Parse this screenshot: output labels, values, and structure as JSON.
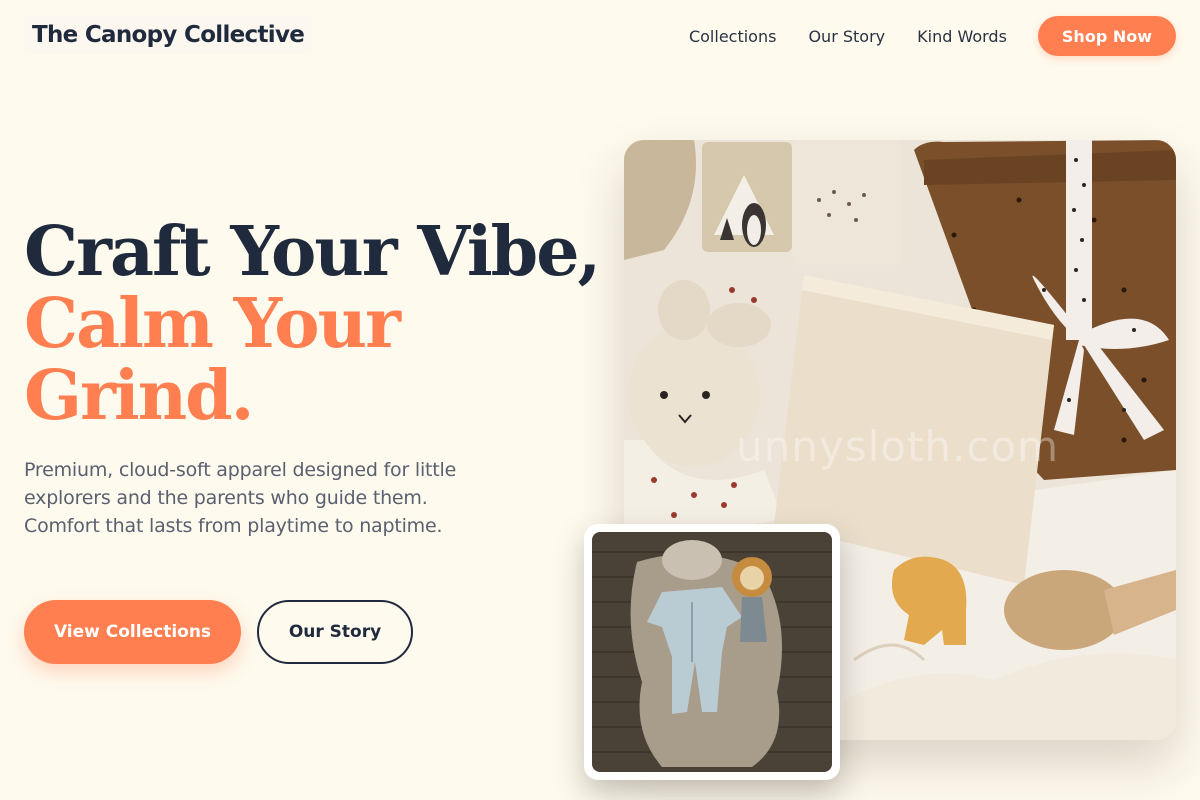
{
  "header": {
    "brand": "The Canopy Collective",
    "nav": [
      {
        "label": "Collections"
      },
      {
        "label": "Our Story"
      },
      {
        "label": "Kind Words"
      }
    ],
    "cta_label": "Shop Now"
  },
  "hero": {
    "headline_line1": "Craft Your Vibe,",
    "headline_accent_line1": "Calm Your",
    "headline_accent_line2": "Grind.",
    "description": "Premium, cloud-soft apparel designed for little explorers and the parents who guide them. Comfort that lasts from playtime to naptime.",
    "primary_button": "View Collections",
    "secondary_button": "Our Story"
  },
  "images": {
    "main_watermark": "unnysloth.com"
  },
  "colors": {
    "background": "#fefaee",
    "accent": "#ff7f50",
    "heading": "#1f2a3d",
    "body_text": "#5a6070"
  }
}
